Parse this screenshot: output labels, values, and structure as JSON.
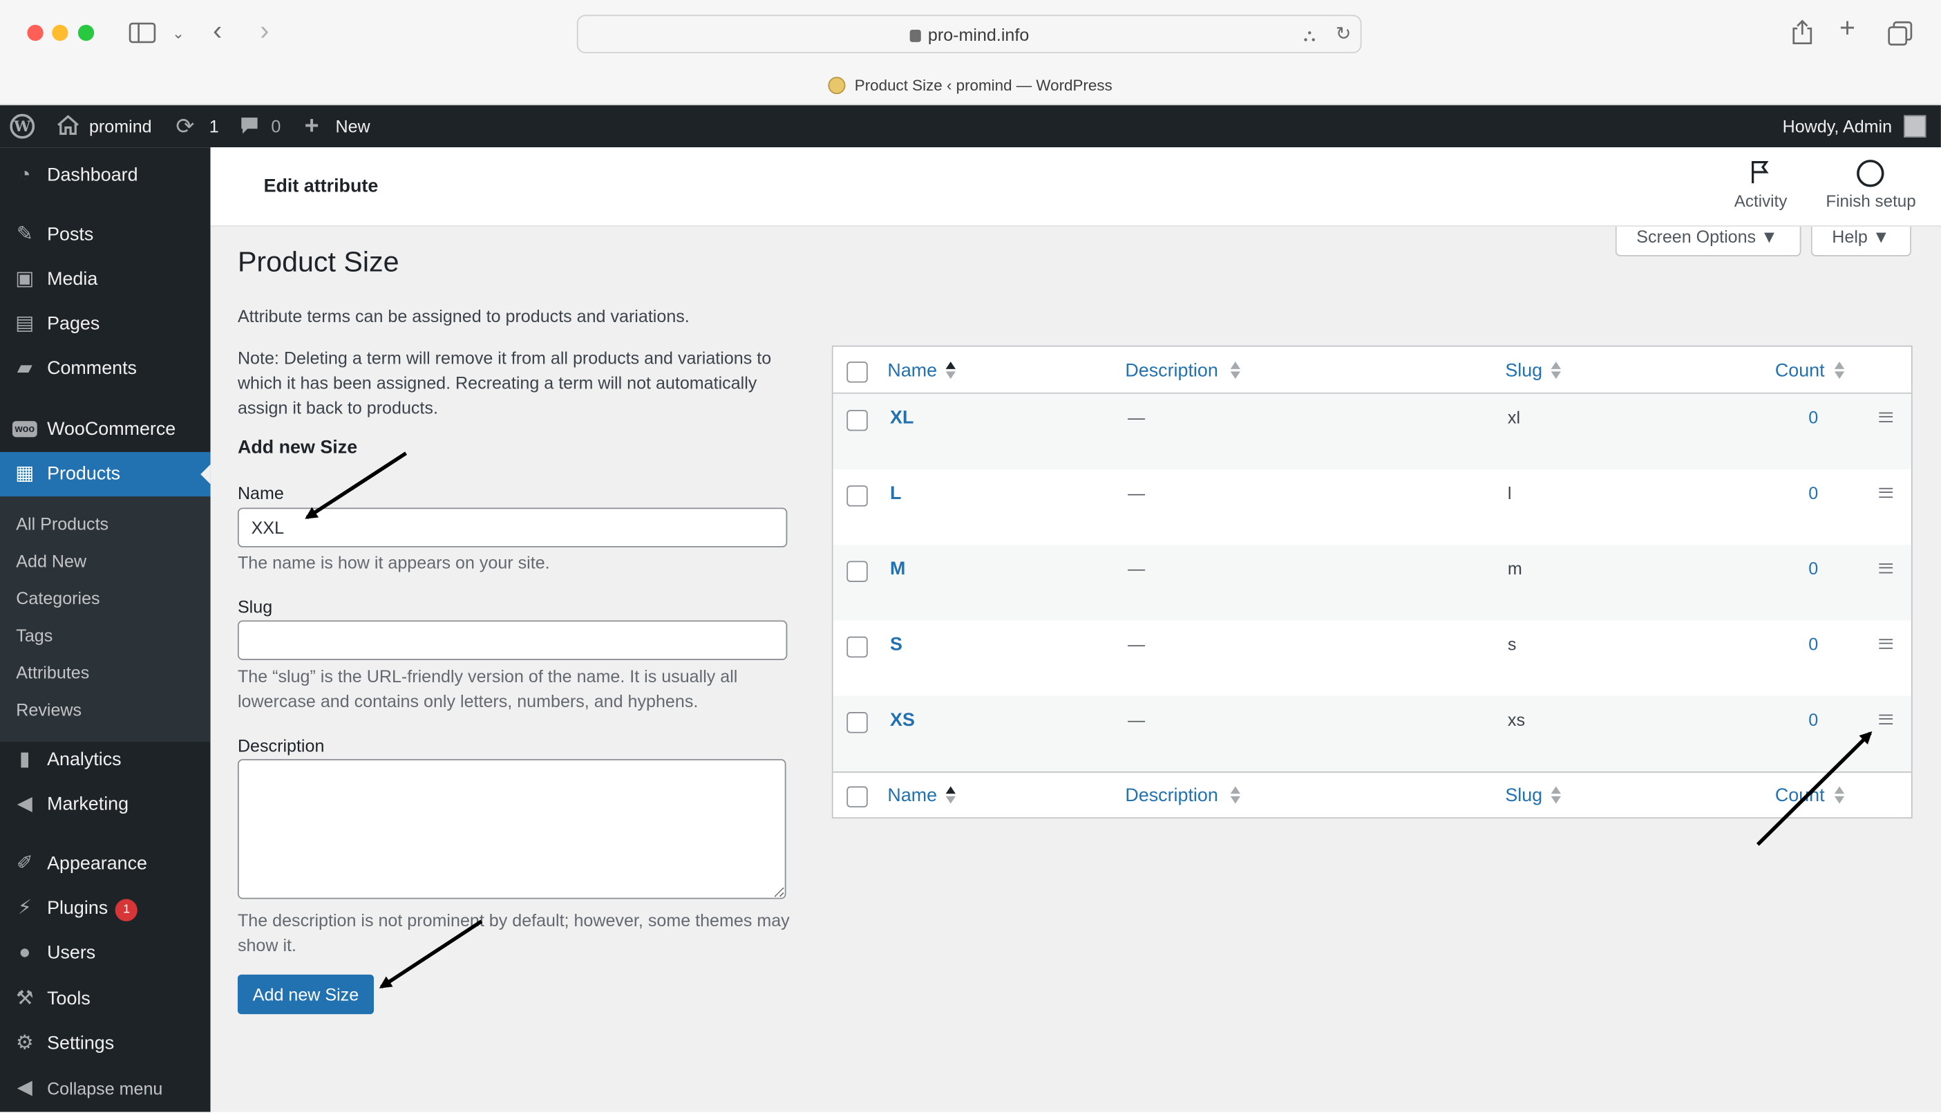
{
  "browser": {
    "url": "pro-mind.info",
    "tab_title": "Product Size ‹ promind — WordPress"
  },
  "adminbar": {
    "site_name": "promind",
    "updates_count": "1",
    "comments_count": "0",
    "new_label": "New",
    "greeting": "Howdy, Admin"
  },
  "sidebar": {
    "items": [
      {
        "label": "Dashboard",
        "icon": "dashboard-icon"
      },
      {
        "label": "Posts",
        "icon": "pin-icon"
      },
      {
        "label": "Media",
        "icon": "media-icon"
      },
      {
        "label": "Pages",
        "icon": "page-icon"
      },
      {
        "label": "Comments",
        "icon": "comment-icon"
      },
      {
        "label": "WooCommerce",
        "icon": "woo-icon"
      },
      {
        "label": "Products",
        "icon": "archive-icon"
      },
      {
        "label": "Analytics",
        "icon": "bar-chart-icon"
      },
      {
        "label": "Marketing",
        "icon": "megaphone-icon"
      },
      {
        "label": "Appearance",
        "icon": "brush-icon"
      },
      {
        "label": "Plugins",
        "icon": "plug-icon"
      },
      {
        "label": "Users",
        "icon": "user-icon"
      },
      {
        "label": "Tools",
        "icon": "wrench-icon"
      },
      {
        "label": "Settings",
        "icon": "sliders-icon"
      },
      {
        "label": "Collapse menu",
        "icon": "collapse-icon"
      }
    ],
    "plugins_badge": "1",
    "submenu": [
      "All Products",
      "Add New",
      "Categories",
      "Tags",
      "Attributes",
      "Reviews"
    ]
  },
  "header": {
    "title": "Edit attribute",
    "activity": "Activity",
    "finish_setup": "Finish setup",
    "screen_options": "Screen Options ▼",
    "help": "Help ▼"
  },
  "page": {
    "title": "Product Size",
    "intro": "Attribute terms can be assigned to products and variations.",
    "note": "Note: Deleting a term will remove it from all products and variations to which it has been assigned. Recreating a term will not automatically assign it back to products.",
    "form_heading": "Add new Size",
    "name_label": "Name",
    "name_value": "XXL",
    "name_help": "The name is how it appears on your site.",
    "slug_label": "Slug",
    "slug_value": "",
    "slug_help": "The “slug” is the URL-friendly version of the name. It is usually all lowercase and contains only letters, numbers, and hyphens.",
    "description_label": "Description",
    "description_help": "The description is not prominent by default; however, some themes may show it.",
    "submit_label": "Add new Size"
  },
  "table": {
    "columns": [
      "Name",
      "Description",
      "Slug",
      "Count"
    ],
    "rows": [
      {
        "name": "XL",
        "description": "—",
        "slug": "xl",
        "count": "0"
      },
      {
        "name": "L",
        "description": "—",
        "slug": "l",
        "count": "0"
      },
      {
        "name": "M",
        "description": "—",
        "slug": "m",
        "count": "0"
      },
      {
        "name": "S",
        "description": "—",
        "slug": "s",
        "count": "0"
      },
      {
        "name": "XS",
        "description": "—",
        "slug": "xs",
        "count": "0"
      }
    ]
  },
  "colors": {
    "admin_dark": "#1d2327",
    "accent": "#2271b1",
    "background": "#f0f0f1",
    "badge": "#d63638"
  }
}
